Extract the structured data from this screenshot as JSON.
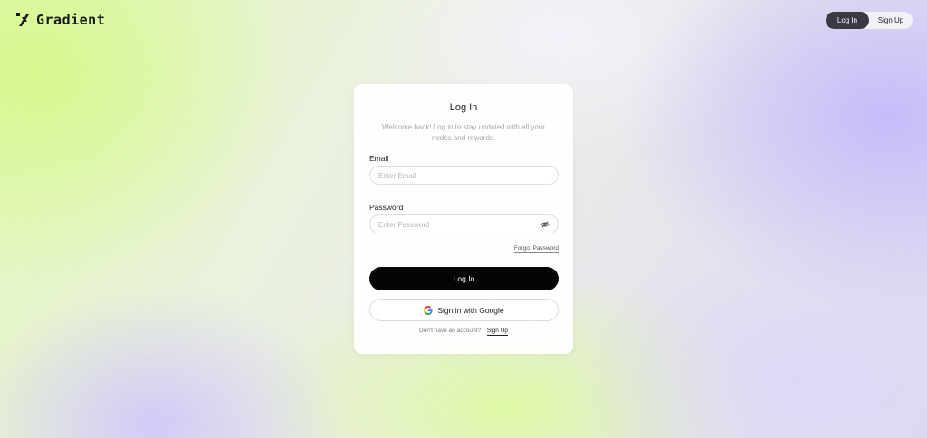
{
  "brand": {
    "name": "Gradient",
    "icon": "gradient-logo-icon"
  },
  "header": {
    "login_label": "Log In",
    "signup_label": "Sign Up",
    "active": "login"
  },
  "card": {
    "title": "Log In",
    "subtitle": "Welcome back! Log in to stay updated with all your nodes and rewards.",
    "email": {
      "label": "Email",
      "placeholder": "Enter Email",
      "value": ""
    },
    "password": {
      "label": "Password",
      "placeholder": "Enter Password",
      "value": "",
      "toggle_icon": "eye-off-icon"
    },
    "forgot_label": "Forgot Password",
    "login_button": "Log In",
    "google_button": "Sign in with Google",
    "google_icon": "google-icon",
    "no_account_text": "Don't have an account?",
    "signup_link": "Sign Up"
  },
  "colors": {
    "primary_button": "#050505",
    "toggle_active": "#3a3a44",
    "background_green": "#d6f88c",
    "background_purple": "#c4b8fa"
  }
}
